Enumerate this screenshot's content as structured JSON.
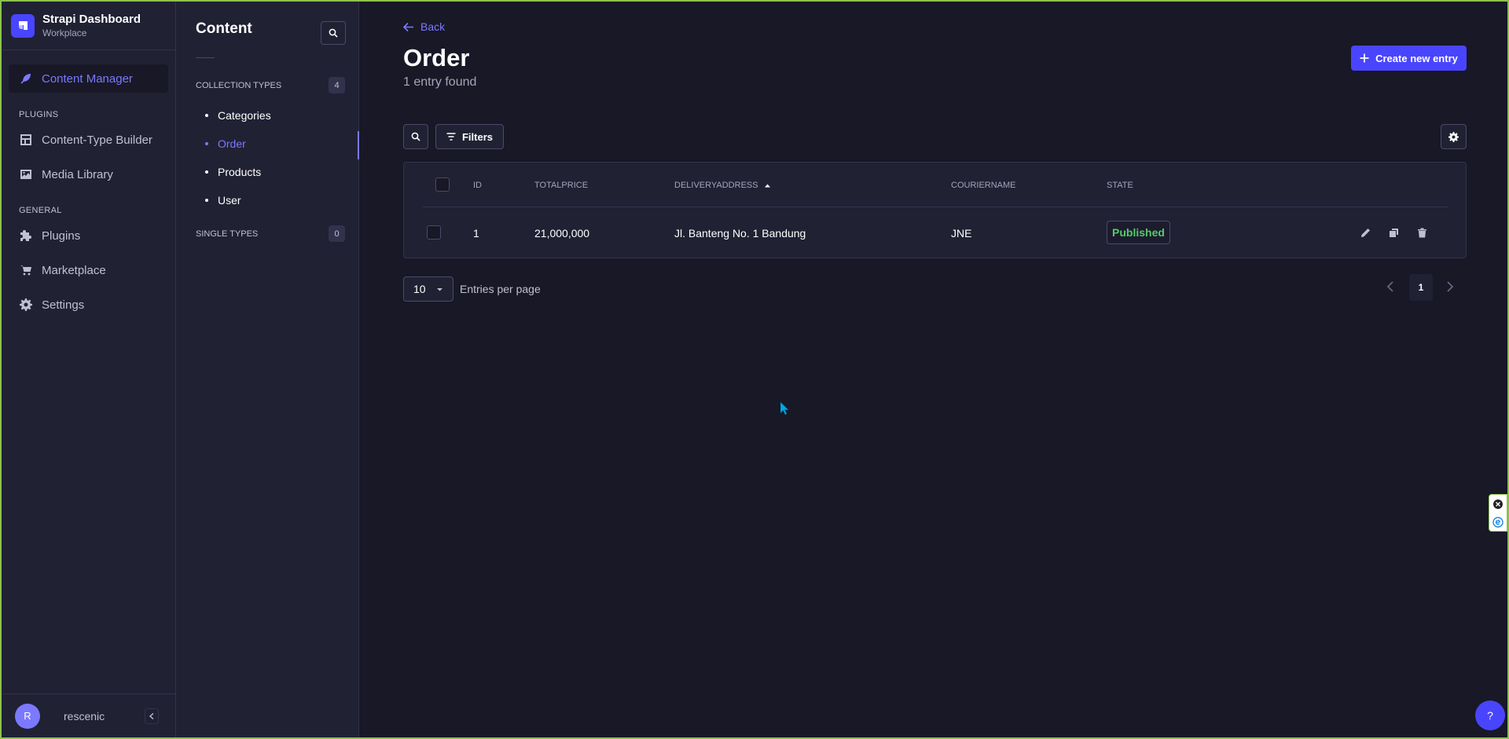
{
  "brand": {
    "title": "Strapi Dashboard",
    "subtitle": "Workplace"
  },
  "nav": {
    "active": {
      "label": "Content Manager",
      "icon": "feather-icon"
    },
    "plugins_heading": "Plugins",
    "plugins": [
      {
        "label": "Content-Type Builder",
        "icon": "layout-icon"
      },
      {
        "label": "Media Library",
        "icon": "image-icon"
      }
    ],
    "general_heading": "General",
    "general": [
      {
        "label": "Plugins",
        "icon": "puzzle-icon"
      },
      {
        "label": "Marketplace",
        "icon": "cart-icon"
      },
      {
        "label": "Settings",
        "icon": "gear-icon"
      }
    ],
    "user": {
      "initial": "R",
      "name": "rescenic"
    }
  },
  "subnav": {
    "title": "Content",
    "collection_types": {
      "label": "Collection types",
      "count": "4"
    },
    "items": [
      {
        "label": "Categories",
        "active": false
      },
      {
        "label": "Order",
        "active": true
      },
      {
        "label": "Products",
        "active": false
      },
      {
        "label": "User",
        "active": false
      }
    ],
    "single_types": {
      "label": "Single types",
      "count": "0"
    }
  },
  "header": {
    "back": "Back",
    "title": "Order",
    "subtitle": "1 entry found",
    "create_button": "Create new entry"
  },
  "toolbar": {
    "filters": "Filters"
  },
  "table": {
    "columns": [
      "id",
      "totalprice",
      "deliveryaddress",
      "couriername",
      "state"
    ],
    "sorted_column": "deliveryaddress",
    "sort_direction": "ascending",
    "rows": [
      {
        "id": "1",
        "totalprice": "21,000,000",
        "deliveryaddress": "Jl. Banteng No. 1 Bandung",
        "couriername": "JNE",
        "state": "Published"
      }
    ]
  },
  "pagination": {
    "per_page": "10",
    "per_page_label": "Entries per page",
    "current_page": "1"
  },
  "help": "?",
  "colors": {
    "accent": "#4945ff",
    "accent_text": "#7b79ff",
    "published": "#55cb68",
    "background": "#181826",
    "panel": "#212134"
  }
}
